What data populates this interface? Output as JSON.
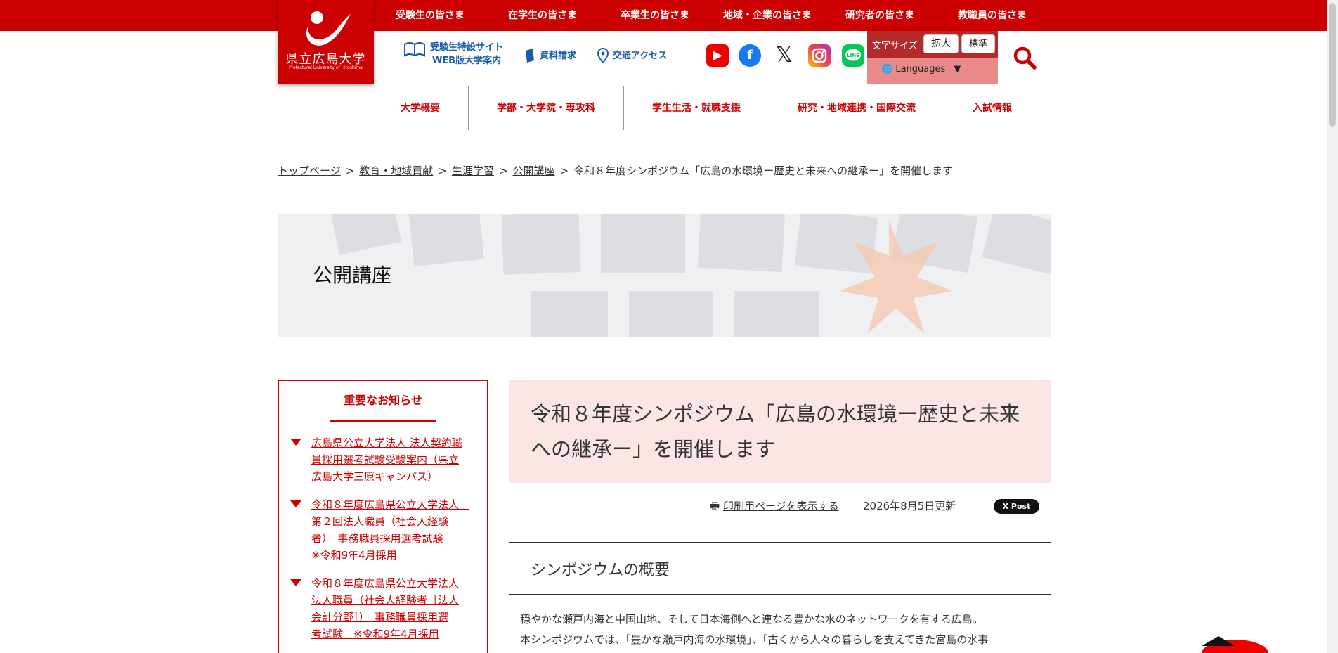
{
  "topnav": [
    "受験生の皆さま",
    "在学生の皆さま",
    "卒業生の皆さま",
    "地域・企業の皆さま",
    "研究者の皆さま",
    "教職員の皆さま"
  ],
  "logo": {
    "name": "県立広島大学",
    "sub": "Prefectural University of Hiroshima"
  },
  "util": {
    "exam_line1": "受験生特設サイト",
    "exam_line2": "WEB版大学案内",
    "request": "資料請求",
    "access": "交通アクセス"
  },
  "social": [
    "youtube-icon",
    "facebook-icon",
    "x-icon",
    "instagram-icon",
    "line-icon"
  ],
  "fontsize": {
    "label": "文字サイズ",
    "large": "拡大",
    "normal": "標準"
  },
  "languages": "Languages",
  "mainnav": [
    "大学概要",
    "学部・大学院・専攻科",
    "学生生活・就職支援",
    "研究・地域連携・国際交流",
    "入試情報"
  ],
  "breadcrumb": {
    "links": [
      "トップページ",
      "教育・地域貢献",
      "生涯学習",
      "公開講座"
    ],
    "current": "令和８年度シンポジウム「広島の水環境ー歴史と未来への継承ー」を開催します"
  },
  "hero_title": "公開講座",
  "sidebar": {
    "title": "重要なお知らせ",
    "items": [
      [
        "広島県公立大学法人 法人契約職",
        "員採用選考試験受験案内（県立",
        "広島大学三原キャンパス）"
      ],
      [
        "令和８年度広島県公立大学法人　",
        "第２回法人職員（社会人経験",
        "者）　事務職員採用選考試験　",
        "※令和9年4月採用"
      ],
      [
        "令和８年度広島県公立大学法人　",
        "法人職員（社会人経験者［法人",
        "会計分野］）　事務職員採用選",
        "考試験　※令和9年4月採用"
      ]
    ]
  },
  "article": {
    "title_line1": "令和８年度シンポジウム「広島の水環境ー歴史と未来",
    "title_line2": "への継承ー」を開催します",
    "print": "印刷用ページを表示する",
    "updated": "2026年8月5日更新",
    "xpost": "X Post",
    "section": "シンポジウムの概要",
    "para1": "穏やかな瀬戸内海と中国山地、そして日本海側へと連なる豊かな水のネットワークを有する広島。",
    "para2": "本シンポジウムでは、「豊かな瀬戸内海の水環境」、「古くから人々の暮らしを支えてきた宮島の水事"
  },
  "colors": {
    "brand": "#cc0000",
    "pink": "#fbe5e5",
    "link_blue": "#1a5aa8"
  }
}
